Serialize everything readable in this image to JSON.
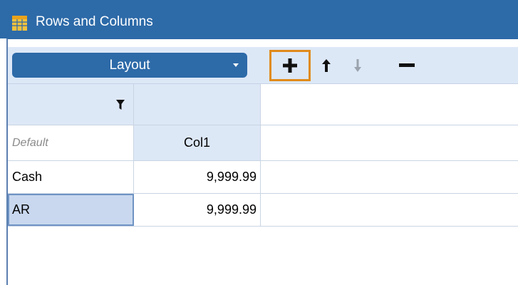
{
  "window": {
    "title": "Rows and Columns"
  },
  "toolbar": {
    "layout_label": "Layout",
    "buttons": [
      "add",
      "move-up",
      "move-down",
      "remove"
    ]
  },
  "grid": {
    "default_label": "Default",
    "column_header": "Col1",
    "rows": [
      {
        "label": "Cash",
        "value": "9,999.99"
      },
      {
        "label": "AR",
        "value": "9,999.99"
      }
    ]
  },
  "colors": {
    "titlebar": "#2d6aa8",
    "toolbar_bg": "#dde8f7",
    "highlight_outline": "#e08b1b"
  }
}
